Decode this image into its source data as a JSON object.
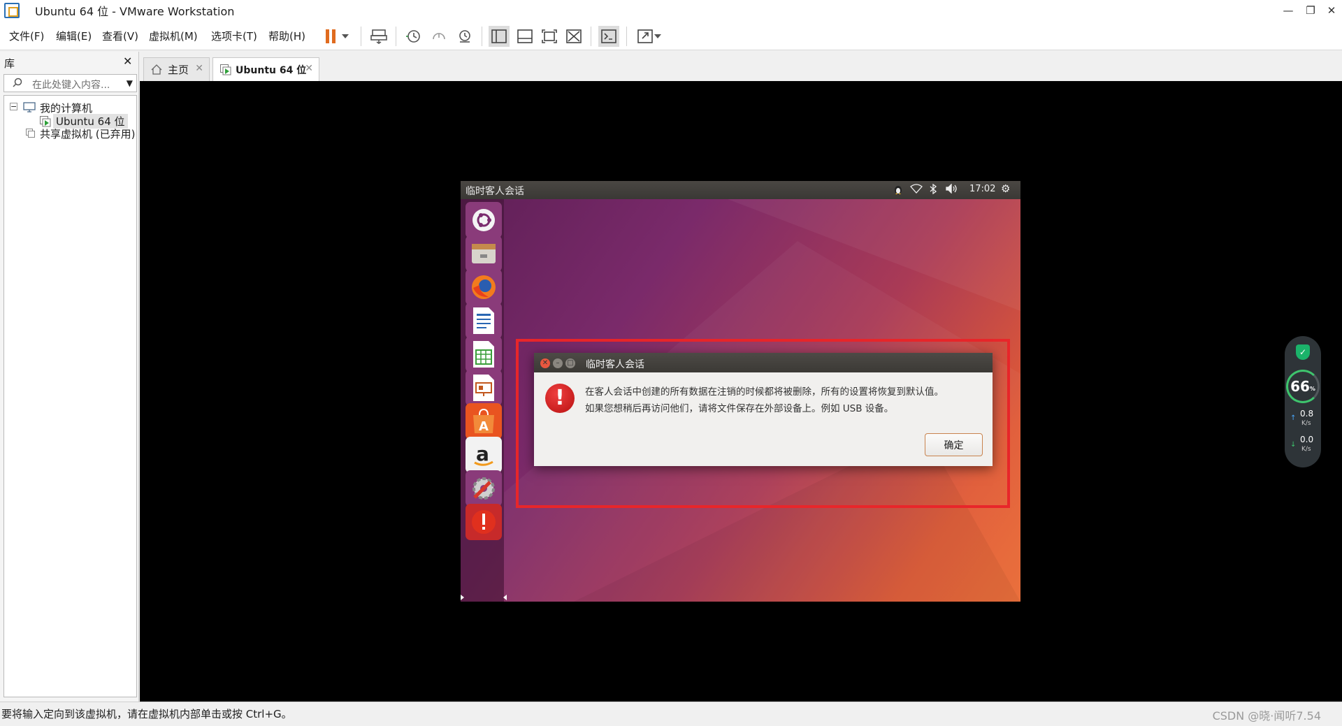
{
  "window": {
    "title": "Ubuntu 64 位 - VMware Workstation"
  },
  "menu": {
    "items": [
      "文件(F)",
      "编辑(E)",
      "查看(V)",
      "虚拟机(M)",
      "选项卡(T)",
      "帮助(H)"
    ]
  },
  "library": {
    "title": "库",
    "search_placeholder": "在此处键入内容...",
    "tree": {
      "my_computer": "我的计算机",
      "vm": "Ubuntu 64 位",
      "shared": "共享虚拟机 (已弃用)"
    }
  },
  "tabs": {
    "home": "主页",
    "vm": "Ubuntu 64 位"
  },
  "guest": {
    "panel_title": "临时客人会话",
    "clock": "17:02",
    "launcher_icons": [
      "ubuntu-dash",
      "files",
      "firefox",
      "libreoffice-writer",
      "libreoffice-calc",
      "libreoffice-impress",
      "ubuntu-software",
      "amazon",
      "system-settings",
      "error-indicator"
    ]
  },
  "dialog": {
    "title": "临时客人会话",
    "message_line1": "在客人会话中创建的所有数据在注销的时候都将被删除，所有的设置将恢复到默认值。",
    "message_line2": "如果您想稍后再访问他们，请将文件保存在外部设备上。例如 USB 设备。",
    "ok_label": "确定"
  },
  "security_widget": {
    "score": "66",
    "score_unit": "%",
    "upload": "0.8",
    "download": "0.0",
    "rate_unit": "K/s"
  },
  "status": {
    "text": "要将输入定向到该虚拟机，请在虚拟机内部单击或按 Ctrl+G。",
    "watermark": "CSDN @晓·闻听7.54"
  },
  "colors": {
    "highlight": "#e8262a",
    "ubuntu_orange": "#e95420",
    "shield_green": "#1bb36a"
  }
}
